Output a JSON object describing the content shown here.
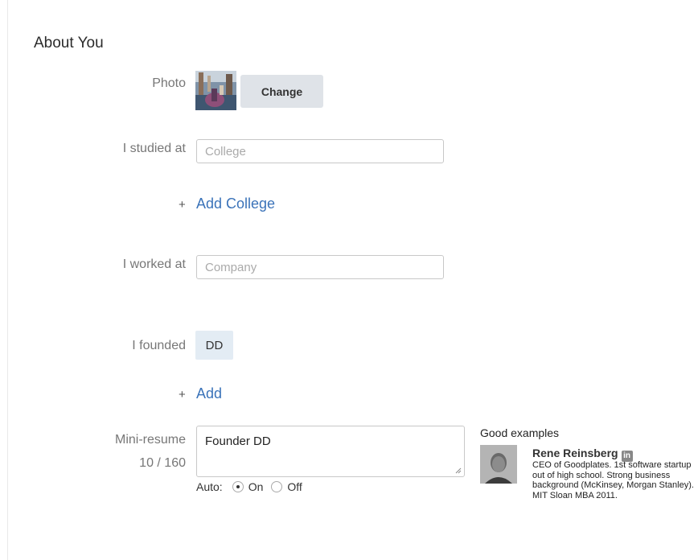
{
  "section": {
    "title": "About You"
  },
  "photo": {
    "label": "Photo",
    "change_label": "Change"
  },
  "studied": {
    "label": "I studied at",
    "placeholder": "College",
    "value": "",
    "add_label": "Add College",
    "plus": "+"
  },
  "worked": {
    "label": "I worked at",
    "placeholder": "Company",
    "value": ""
  },
  "founded": {
    "label": "I founded",
    "tag": "DD",
    "add_label": "Add",
    "plus": "+"
  },
  "resume": {
    "label": "Mini-resume",
    "counter": "10 / 160",
    "value": "Founder DD",
    "auto_label": "Auto:",
    "on_label": "On",
    "off_label": "Off",
    "selected": "On"
  },
  "examples": {
    "title": "Good examples",
    "name": "Rene Reinsberg",
    "linkedin_icon": "in",
    "bio": "CEO of Goodplates. 1st software startup out of high school. Strong business background (McKinsey, Morgan Stanley). MIT Sloan MBA 2011."
  },
  "colors": {
    "link": "#3b73b9",
    "button_bg": "#dfe3e8",
    "tag_bg": "#e3ecf4"
  }
}
